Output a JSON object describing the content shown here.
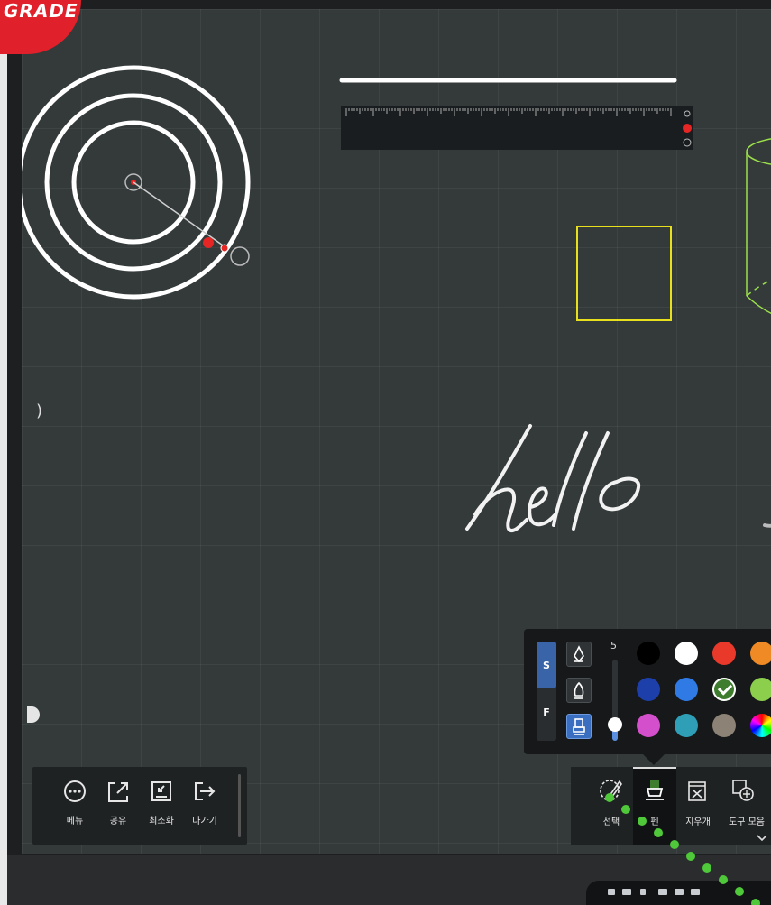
{
  "ribbon": {
    "text": "GRADE"
  },
  "canvas": {
    "handwriting": "hello",
    "shapes": [
      "concentric-circles",
      "line",
      "ruler",
      "square",
      "cylinder"
    ],
    "colors": {
      "board": "#343a3a",
      "square": "#e8e01c",
      "cylinder": "#9be04a",
      "stroke": "#ffffff"
    }
  },
  "left_toolbar": {
    "items": [
      {
        "label": "메뉴",
        "icon": "more-circle-icon"
      },
      {
        "label": "공유",
        "icon": "share-icon"
      },
      {
        "label": "최소화",
        "icon": "minimize-icon"
      },
      {
        "label": "나가기",
        "icon": "exit-icon"
      }
    ]
  },
  "right_toolbar": {
    "items": [
      {
        "label": "선택",
        "icon": "select-lasso-icon"
      },
      {
        "label": "펜",
        "icon": "pen-icon",
        "active": true
      },
      {
        "label": "지우개",
        "icon": "eraser-icon"
      },
      {
        "label": "도구 모음",
        "icon": "toolbox-icon"
      }
    ]
  },
  "pen_panel": {
    "mode_s": "S",
    "mode_f": "F",
    "selected_mode": "S",
    "size_value": "5",
    "pen_types": [
      "pen-tip-icon",
      "marker-tip-icon",
      "highlighter-icon"
    ],
    "selected_pen_type": 2,
    "colors": [
      [
        "#000000",
        "#ffffff",
        "#e8392b",
        "#f08a24"
      ],
      [
        "#1d3faa",
        "#2f7ae5",
        "#3f7d2e",
        "#8ccf4d"
      ],
      [
        "#d44fcb",
        "#2f9fb7",
        "#8c8376",
        "rainbow"
      ]
    ],
    "selected_color": "#3f7d2e"
  }
}
